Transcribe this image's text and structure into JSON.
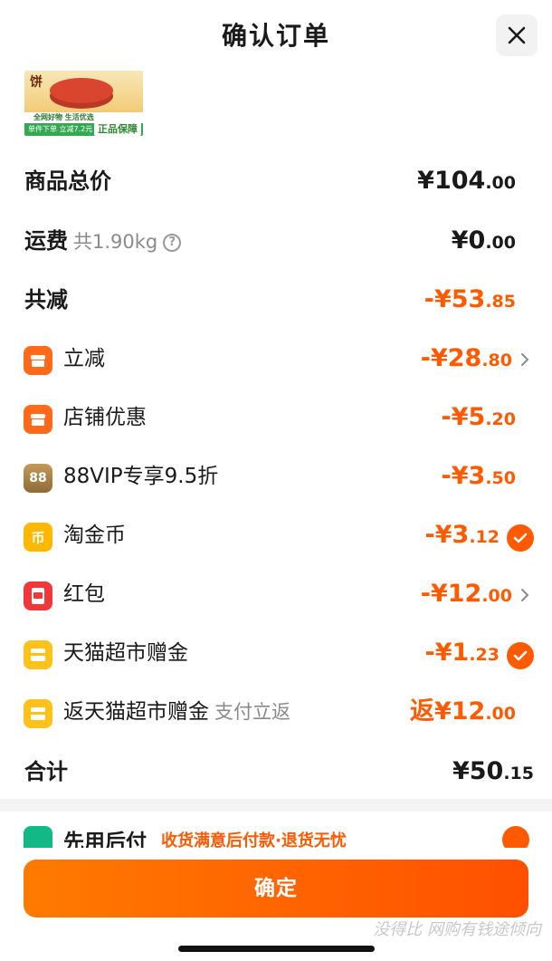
{
  "header": {
    "title": "确认订单",
    "close_icon": "close-icon"
  },
  "product_thumb": {
    "char": "饼",
    "line1": "全网好物 生活优选",
    "line2": "单件下单 立减7.2元",
    "badge": "正品保障"
  },
  "summary": {
    "total_label": "商品总价",
    "total_currency": "¥",
    "total_int": "104",
    "total_dec": ".00",
    "shipping_label": "运费",
    "shipping_weight": "共1.90kg",
    "shipping_help": "?",
    "shipping_currency": "¥",
    "shipping_int": "0",
    "shipping_dec": ".00",
    "reduce_label": "共减",
    "reduce_prefix": "-¥",
    "reduce_int": "53",
    "reduce_dec": ".85"
  },
  "discounts": [
    {
      "label": "立减",
      "prefix": "-¥",
      "int": "28",
      "dec": ".80",
      "icon": "shop-icon",
      "action": "chevron"
    },
    {
      "label": "店铺优惠",
      "prefix": "-¥",
      "int": "5",
      "dec": ".20",
      "icon": "store-icon",
      "action": "none"
    },
    {
      "label": "88VIP专享9.5折",
      "prefix": "-¥",
      "int": "3",
      "dec": ".50",
      "icon": "vip-88-icon",
      "icon_text": "88",
      "action": "none"
    },
    {
      "label": "淘金币",
      "prefix": "-¥",
      "int": "3",
      "dec": ".12",
      "icon": "coin-icon",
      "icon_text": "币",
      "action": "check"
    },
    {
      "label": "红包",
      "prefix": "-¥",
      "int": "12",
      "dec": ".00",
      "icon": "red-packet-icon",
      "action": "chevron"
    },
    {
      "label": "天猫超市赠金",
      "prefix": "-¥",
      "int": "1",
      "dec": ".23",
      "icon": "gift-box-icon",
      "action": "check"
    },
    {
      "label": "返天猫超市赠金",
      "sub": "支付立返",
      "prefix": "返¥",
      "int": "12",
      "dec": ".00",
      "icon": "gift-box-icon",
      "action": "none"
    }
  ],
  "total": {
    "label": "合计",
    "currency": "¥",
    "int": "50",
    "dec": ".15"
  },
  "pay_later": {
    "title": "先用后付",
    "desc": "收货满意后付款·退货无忧"
  },
  "confirm_button": "确定",
  "watermark": "没得比 网购有钱途倾向",
  "colors": {
    "accent": "#ff5a00",
    "text": "#1a1a1a",
    "muted": "#8a8a8a"
  }
}
